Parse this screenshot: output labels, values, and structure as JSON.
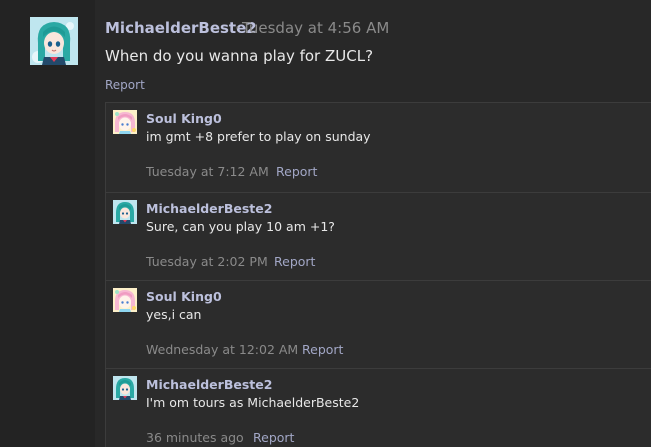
{
  "post": {
    "author": "MichaelderBeste2",
    "separator": "·",
    "time": "Tuesday at 4:56 AM",
    "body": "When do you wanna play for ZUCL?",
    "report_label": "Report",
    "avatar_icon": "anime-avatar-teal-hair"
  },
  "replies": [
    {
      "author": "Soul King0",
      "body": "im gmt +8 prefer to play on sunday",
      "time": "Tuesday at 7:12 AM",
      "report_label": "Report",
      "avatar_icon": "anime-avatar-pastel"
    },
    {
      "author": "MichaelderBeste2",
      "body": "Sure, can you play 10 am +1?",
      "time": "Tuesday at 2:02 PM",
      "report_label": "Report",
      "avatar_icon": "anime-avatar-teal-hair"
    },
    {
      "author": "Soul King0",
      "body": "yes,i can",
      "time": "Wednesday at 12:02 AM",
      "report_label": "Report",
      "avatar_icon": "anime-avatar-pastel"
    },
    {
      "author": "MichaelderBeste2",
      "body": "I'm om tours as MichaelderBeste2",
      "time": "36 minutes ago",
      "report_label": "Report",
      "avatar_icon": "anime-avatar-teal-hair"
    }
  ],
  "colors": {
    "author": "#bcc0dc",
    "link": "#a2a7c6",
    "muted": "#8a8a8a",
    "text": "#e8e8e8",
    "background": "#282828"
  }
}
